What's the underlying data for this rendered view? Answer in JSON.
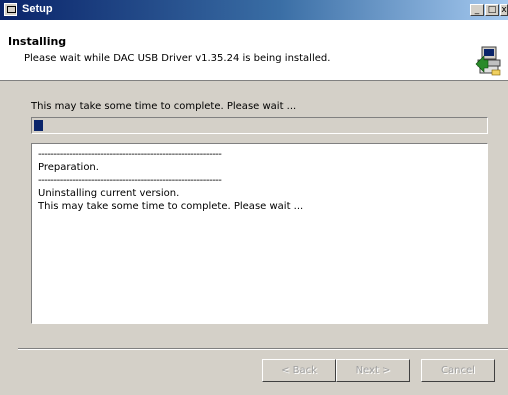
{
  "window": {
    "title": "Setup",
    "minimize_symbol": "_",
    "maximize_symbol": "□",
    "close_symbol": "x"
  },
  "header": {
    "title": "Installing",
    "subtitle": "Please wait while DAC USB Driver v1.35.24 is being installed.",
    "icon": "installer-computer-icon"
  },
  "info_text": "This may take some time to complete. Please wait ...",
  "progress": {
    "fraction": 0.02,
    "color": "#0a246a"
  },
  "log": {
    "lines": [
      "-----------------------------------------------------------",
      "Preparation.",
      "-----------------------------------------------------------",
      "Uninstalling current version.",
      "This may take some time to complete. Please wait ..."
    ]
  },
  "buttons": {
    "back": "< Back",
    "next": "Next >",
    "cancel": "Cancel"
  }
}
